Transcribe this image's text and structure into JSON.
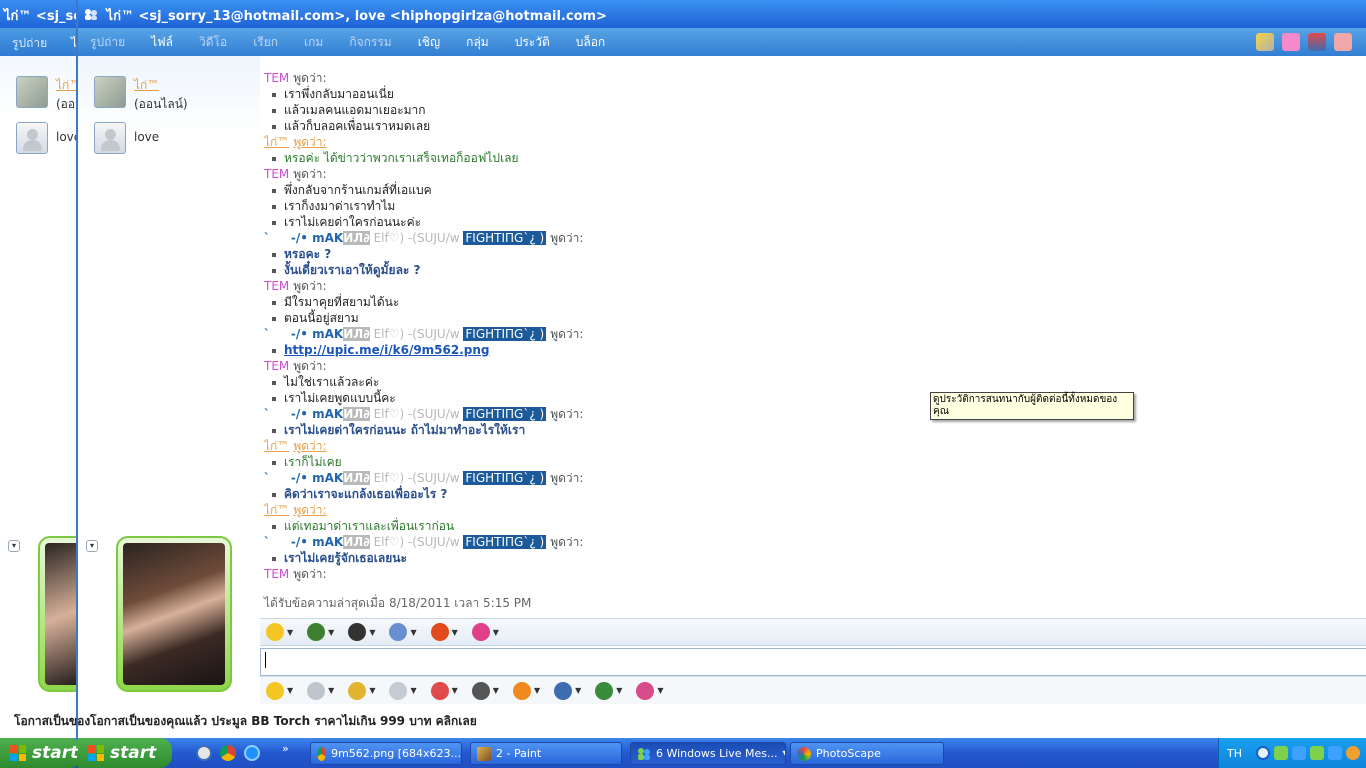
{
  "background_window": {
    "title": "ไก่™ <sj_sorry_13@hotmail.com>, love <hiphopgirlza@hotmail.com>",
    "menu": [
      "รูปถ่าย",
      "ไฟล์"
    ],
    "contacts": [
      {
        "name": "ไก่™",
        "status": "(ออนไลน์)"
      },
      {
        "name": "love"
      }
    ],
    "ad": "โอกาสเป็นของคุณแล้ว ประมูล BB Torch ราคาไม่เกิน 999 บาท คลิกเลย"
  },
  "window": {
    "title": "ไก่™ <sj_sorry_13@hotmail.com>, love <hiphopgirlza@hotmail.com>",
    "menu": [
      {
        "label": "รูปถ่าย",
        "dim": true
      },
      {
        "label": "ไฟล์",
        "dim": false
      },
      {
        "label": "วิดีโอ",
        "dim": true
      },
      {
        "label": "เรียก",
        "dim": true
      },
      {
        "label": "เกม",
        "dim": true
      },
      {
        "label": "กิจกรรม",
        "dim": true
      },
      {
        "label": "เชิญ",
        "dim": false
      },
      {
        "label": "กลุ่ม",
        "dim": false
      },
      {
        "label": "ประวัติ",
        "dim": false
      },
      {
        "label": "บล็อก",
        "dim": false
      }
    ]
  },
  "contacts": [
    {
      "name": "ไก่™",
      "status": "(ออนไลน์)"
    },
    {
      "name": "love"
    }
  ],
  "chat": {
    "says": "พูดว่า:",
    "speakers": {
      "tem": "TEM",
      "kai": "ไก่™",
      "akiko": {
        "prefix": "`     -/• mAK",
        "hl": "ИЛ∂",
        "elf": " Elf♡) -(SUJU/w ",
        "fight": "FIGHTIΠG`¿ )"
      }
    },
    "lines": [
      {
        "kind": "speaker",
        "who": "tem"
      },
      {
        "kind": "msg",
        "style": "plain",
        "text": "เราพึ่งกลับมาออนเนี่ย"
      },
      {
        "kind": "msg",
        "style": "plain",
        "text": "แล้วเมลคนแอดมาเยอะมาก"
      },
      {
        "kind": "msg",
        "style": "plain",
        "text": "แล้วก็บลอคเพื่อนเราหมดเลย"
      },
      {
        "kind": "speaker",
        "who": "kai"
      },
      {
        "kind": "msg",
        "style": "green",
        "text": "หรอค่ะ ได้ข่าวว่าพวกเราเสร็จเทอก็ออฟไปเลย"
      },
      {
        "kind": "speaker",
        "who": "tem"
      },
      {
        "kind": "msg",
        "style": "plain",
        "text": "พึ่งกลับจากร้านเกมส์ที่เอแบค"
      },
      {
        "kind": "msg",
        "style": "plain",
        "text": "เราก็งงมาด่าเราทำไม"
      },
      {
        "kind": "msg",
        "style": "plain",
        "text": "เราไม่เคยด่าใครก่อนนะค่ะ"
      },
      {
        "kind": "speaker",
        "who": "akiko"
      },
      {
        "kind": "msg",
        "style": "blue",
        "text": "หรอคะ ?"
      },
      {
        "kind": "msg",
        "style": "blue",
        "text": "งั้นเดี๋ยวเราเอาให้ดูมั้ยละ ?"
      },
      {
        "kind": "speaker",
        "who": "tem"
      },
      {
        "kind": "msg",
        "style": "plain",
        "text": "มีใรมาคุยที่สยามได้นะ"
      },
      {
        "kind": "msg",
        "style": "plain",
        "text": "ตอนนี้อยู่สยาม"
      },
      {
        "kind": "speaker",
        "who": "akiko"
      },
      {
        "kind": "msg",
        "style": "link",
        "text": "http://upic.me/i/k6/9m562.png"
      },
      {
        "kind": "speaker",
        "who": "tem"
      },
      {
        "kind": "msg",
        "style": "plain",
        "text": "ไม่ใช่เราแล้วละค่ะ"
      },
      {
        "kind": "msg",
        "style": "plain",
        "text": "เราไม่เคยพูดแบบนี้คะ"
      },
      {
        "kind": "speaker",
        "who": "akiko"
      },
      {
        "kind": "msg",
        "style": "blue",
        "text": "เราไม่เคยด่าใครก่อนนะ ถ้าไม่มาทำอะไรให้เรา"
      },
      {
        "kind": "speaker",
        "who": "kai"
      },
      {
        "kind": "msg",
        "style": "green",
        "text": "เราก็ไม่เคย"
      },
      {
        "kind": "speaker",
        "who": "akiko"
      },
      {
        "kind": "msg",
        "style": "blue",
        "text": "คิดว่าเราจะแกล้งเธอเพื่ออะไร ?"
      },
      {
        "kind": "speaker",
        "who": "kai"
      },
      {
        "kind": "msg",
        "style": "green",
        "text": "แต่เทอมาด่าเราและเพื่อนเราก่อน"
      },
      {
        "kind": "speaker",
        "who": "akiko"
      },
      {
        "kind": "msg",
        "style": "blue",
        "text": "เราไม่เคยรู้จักเธอเลยนะ"
      },
      {
        "kind": "speaker",
        "who": "tem"
      }
    ]
  },
  "last_message": "ได้รับข้อความล่าสุดเมื่อ 8/18/2011 เวลา 5:15 PM",
  "tooltip": "ดูประวัติการสนทนากับผู้ติดต่อนี้ทั้งหมดของคุณ",
  "ad": "โอกาสเป็นของคุณแล้ว ประมูล BB Torch ราคาไม่เกิน 999 บาท คลิกเลย",
  "toolbar_top": [
    {
      "icon": "emoticon-icon",
      "color": "#f3c623"
    },
    {
      "icon": "wink-icon",
      "color": "#3e7f2f"
    },
    {
      "icon": "video-camera-icon",
      "color": "#333333"
    },
    {
      "icon": "background-icon",
      "color": "#6a8fd0"
    },
    {
      "icon": "nudge-icon",
      "color": "#e24a1b"
    },
    {
      "icon": "font-style-icon",
      "color": "#e0408a"
    }
  ],
  "toolbar_bottom": [
    {
      "icon": "smiley-icon",
      "color": "#f3c623"
    },
    {
      "icon": "voice-clip-icon",
      "color": "#bfc5cc"
    },
    {
      "icon": "nudge-shake-icon",
      "color": "#e2b430"
    },
    {
      "icon": "ink-icon",
      "color": "#c5cbd2"
    },
    {
      "icon": "color-grid-icon",
      "color": "#e04a4a"
    },
    {
      "icon": "audio-icon",
      "color": "#555555"
    },
    {
      "icon": "handwriting-icon",
      "color": "#f08a20"
    },
    {
      "icon": "text-format-icon",
      "color": "#3d6db0"
    },
    {
      "icon": "share-icon",
      "color": "#3a8c3a"
    },
    {
      "icon": "photo-icon",
      "color": "#d94c8c"
    }
  ],
  "taskbar": {
    "start": "start",
    "tasks": [
      {
        "label": "9m562.png [684x623...",
        "active": false
      },
      {
        "label": "2 - Paint",
        "active": false
      },
      {
        "label": "6 Windows Live Mes...",
        "active": true
      },
      {
        "label": "PhotoScape",
        "active": false
      }
    ],
    "lang": "TH"
  }
}
